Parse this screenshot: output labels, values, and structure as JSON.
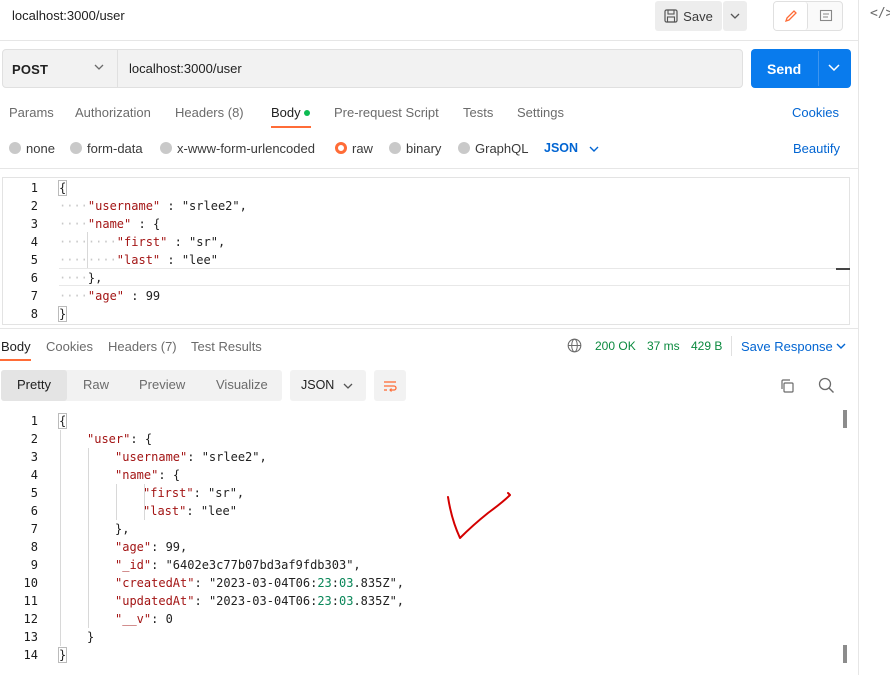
{
  "window": {
    "title": "localhost:3000/user"
  },
  "toolbar": {
    "save_label": "Save",
    "code_icon": "</>"
  },
  "request": {
    "method": "POST",
    "url": "localhost:3000/user",
    "send_label": "Send"
  },
  "request_tabs": [
    {
      "label": "Params"
    },
    {
      "label": "Authorization"
    },
    {
      "label": "Headers (8)"
    },
    {
      "label": "Body"
    },
    {
      "label": "Pre-request Script"
    },
    {
      "label": "Tests"
    },
    {
      "label": "Settings"
    }
  ],
  "cookies_label": "Cookies",
  "body_types": [
    {
      "label": "none"
    },
    {
      "label": "form-data"
    },
    {
      "label": "x-www-form-urlencoded"
    },
    {
      "label": "raw"
    },
    {
      "label": "binary"
    },
    {
      "label": "GraphQL"
    }
  ],
  "body_format": "JSON",
  "beautify_label": "Beautify",
  "request_body_lines": [
    {
      "n": "1",
      "text": "{"
    },
    {
      "n": "2",
      "text": "\"username\" : \"srlee2\","
    },
    {
      "n": "3",
      "text": "\"name\" : {"
    },
    {
      "n": "4",
      "text": "\"first\" : \"sr\","
    },
    {
      "n": "5",
      "text": "\"last\" : \"lee\""
    },
    {
      "n": "6",
      "text": "},"
    },
    {
      "n": "7",
      "text": "\"age\" : 99"
    },
    {
      "n": "8",
      "text": "}"
    }
  ],
  "response_tabs": [
    {
      "label": "Body"
    },
    {
      "label": "Cookies"
    },
    {
      "label": "Headers (7)"
    },
    {
      "label": "Test Results"
    }
  ],
  "response_status": {
    "code": "200 OK",
    "time": "37 ms",
    "size": "429 B"
  },
  "save_response_label": "Save Response",
  "view_modes": [
    {
      "label": "Pretty"
    },
    {
      "label": "Raw"
    },
    {
      "label": "Preview"
    },
    {
      "label": "Visualize"
    }
  ],
  "response_format": "JSON",
  "response_body_lines": [
    {
      "n": "1",
      "text": "{"
    },
    {
      "n": "2",
      "text": "\"user\": {"
    },
    {
      "n": "3",
      "text": "\"username\": \"srlee2\","
    },
    {
      "n": "4",
      "text": "\"name\": {"
    },
    {
      "n": "5",
      "text": "\"first\": \"sr\","
    },
    {
      "n": "6",
      "text": "\"last\": \"lee\""
    },
    {
      "n": "7",
      "text": "},"
    },
    {
      "n": "8",
      "text": "\"age\": 99,"
    },
    {
      "n": "9",
      "text": "\"_id\": \"6402e3c77b07bd3af9fdb303\","
    },
    {
      "n": "10",
      "text": "\"createdAt\": \"2023-03-04T06:23:03.835Z\","
    },
    {
      "n": "11",
      "text": "\"updatedAt\": \"2023-03-04T06:23:03.835Z\","
    },
    {
      "n": "12",
      "text": "\"__v\": 0"
    },
    {
      "n": "13",
      "text": "}"
    },
    {
      "n": "14",
      "text": "}"
    }
  ],
  "colors": {
    "accent": "#ff6c37",
    "primary": "#097bed",
    "link": "#0265d2",
    "status_ok": "#0b8a3f",
    "annotation": "#d40000"
  },
  "icons": [
    "save-icon",
    "chevron-down-icon",
    "pencil-icon",
    "comment-icon",
    "code-icon",
    "globe-icon",
    "wrap-lines-icon",
    "copy-icon",
    "search-icon",
    "checkmark-annotation"
  ]
}
